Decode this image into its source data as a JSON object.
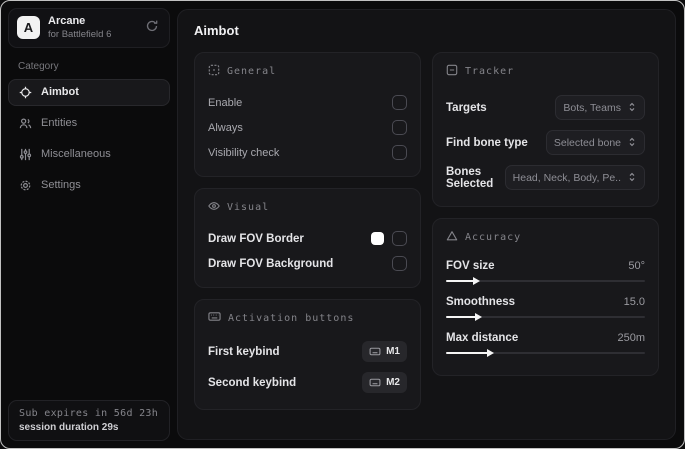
{
  "brand": {
    "logo_letter": "A",
    "title": "Arcane",
    "subtitle": "for Battlefield 6"
  },
  "sidebar": {
    "category_label": "Category",
    "items": [
      {
        "label": "Aimbot",
        "icon": "crosshair-icon",
        "active": true
      },
      {
        "label": "Entities",
        "icon": "entities-icon",
        "active": false
      },
      {
        "label": "Miscellaneous",
        "icon": "sliders-icon",
        "active": false
      },
      {
        "label": "Settings",
        "icon": "gear-icon",
        "active": false
      }
    ],
    "subscription": {
      "expires": "Sub expires in 56d 23h",
      "session": "session duration 29s"
    }
  },
  "main": {
    "title": "Aimbot",
    "general": {
      "title": "General",
      "rows": [
        {
          "label": "Enable",
          "checked": false
        },
        {
          "label": "Always",
          "checked": false
        },
        {
          "label": "Visibility check",
          "checked": false
        }
      ]
    },
    "visual": {
      "title": "Visual",
      "rows": [
        {
          "label": "Draw FOV Border",
          "checked": false,
          "swatch_color": "#ffffff"
        },
        {
          "label": "Draw FOV Background",
          "checked": false
        }
      ]
    },
    "activation": {
      "title": "Activation buttons",
      "rows": [
        {
          "label": "First keybind",
          "key": "M1"
        },
        {
          "label": "Second keybind",
          "key": "M2"
        }
      ]
    },
    "tracker": {
      "title": "Tracker",
      "rows": [
        {
          "label": "Targets",
          "value": "Bots, Teams"
        },
        {
          "label": "Find bone type",
          "value": "Selected bone"
        },
        {
          "label": "Bones Selected",
          "value": "Head, Neck, Body, Pe.."
        }
      ]
    },
    "accuracy": {
      "title": "Accuracy",
      "rows": [
        {
          "label": "FOV size",
          "value": "50°",
          "fill_pct": 14
        },
        {
          "label": "Smoothness",
          "value": "15.0",
          "fill_pct": 15
        },
        {
          "label": "Max distance",
          "value": "250m",
          "fill_pct": 21
        }
      ]
    }
  },
  "colors": {
    "accent": "#f5f5f5",
    "fov_border_swatch": "#ffffff",
    "card_bg": "#18181b",
    "panel_bg": "#131315",
    "window_bg": "#0b0b0c"
  }
}
